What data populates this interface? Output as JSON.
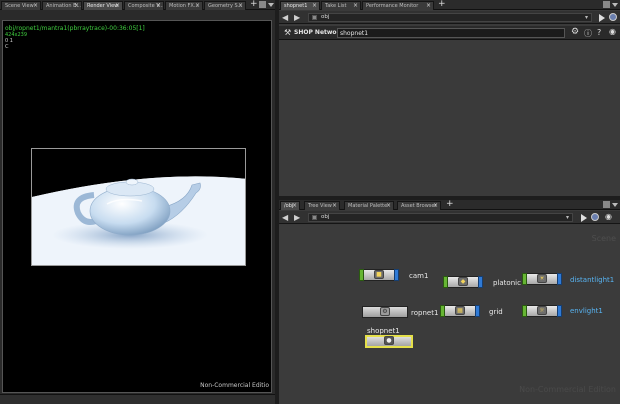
{
  "left_pane": {
    "tabs": [
      {
        "label": "Scene View",
        "close": "×"
      },
      {
        "label": "Animation E...",
        "close": "×"
      },
      {
        "label": "Render View",
        "close": "×",
        "active": true
      },
      {
        "label": "Composite V...",
        "close": "×"
      },
      {
        "label": "Motion FX...",
        "close": "×"
      },
      {
        "label": "Geometry S...",
        "close": "×"
      }
    ],
    "add": "+",
    "render_info": {
      "line1": "obj/ropnet1/mantra1(pbrraytrace)-00:36:05[1]",
      "line2": "424x239",
      "line3": "0 1",
      "line4": "C"
    },
    "watermark": "Non-Commercial Editio"
  },
  "top_right": {
    "tabs": [
      {
        "label": "shopnet1",
        "close": "×",
        "active": true
      },
      {
        "label": "Take List",
        "close": "×"
      },
      {
        "label": "Performance Monitor",
        "close": "×"
      }
    ],
    "add": "+",
    "path": "obj",
    "back": "◀",
    "forward": "▶",
    "network_type": "SHOP Network",
    "network_name": "shopnet1"
  },
  "bottom_right": {
    "tabs": [
      {
        "label": "/obj",
        "close": "×",
        "active": true
      },
      {
        "label": "Tree View",
        "close": "×"
      },
      {
        "label": "Material Palette",
        "close": "×"
      },
      {
        "label": "Asset Browser",
        "close": "×"
      }
    ],
    "add": "+",
    "path": "obj",
    "back": "◀",
    "forward": "▶",
    "context_label": "Scene",
    "watermark": "Non-Commercial Edition",
    "nodes": [
      {
        "name": "cam1",
        "icon": "camera-icon",
        "glyph": "■",
        "blue": false
      },
      {
        "name": "platonic",
        "icon": "platonic-icon",
        "glyph": "◆",
        "blue": false
      },
      {
        "name": "distantlight1",
        "icon": "distant-light-icon",
        "glyph": "☀",
        "blue": true
      },
      {
        "name": "ropnet1",
        "icon": "rop-network-icon",
        "glyph": "⚙",
        "blue": false
      },
      {
        "name": "grid",
        "icon": "grid-icon",
        "glyph": "▦",
        "blue": false
      },
      {
        "name": "envlight1",
        "icon": "env-light-icon",
        "glyph": "☼",
        "blue": true
      },
      {
        "name": "shopnet1",
        "icon": "shop-network-icon",
        "glyph": "●",
        "blue": false
      }
    ]
  },
  "colors": {
    "panel_bg": "#3a3a3a",
    "viewport_bg": "#000000",
    "render_text": "#3fcf3f",
    "node_input": "#66b533",
    "node_output": "#2f7ad6",
    "selected_node": "#e5e04a",
    "blue_label": "#58b4f2"
  }
}
